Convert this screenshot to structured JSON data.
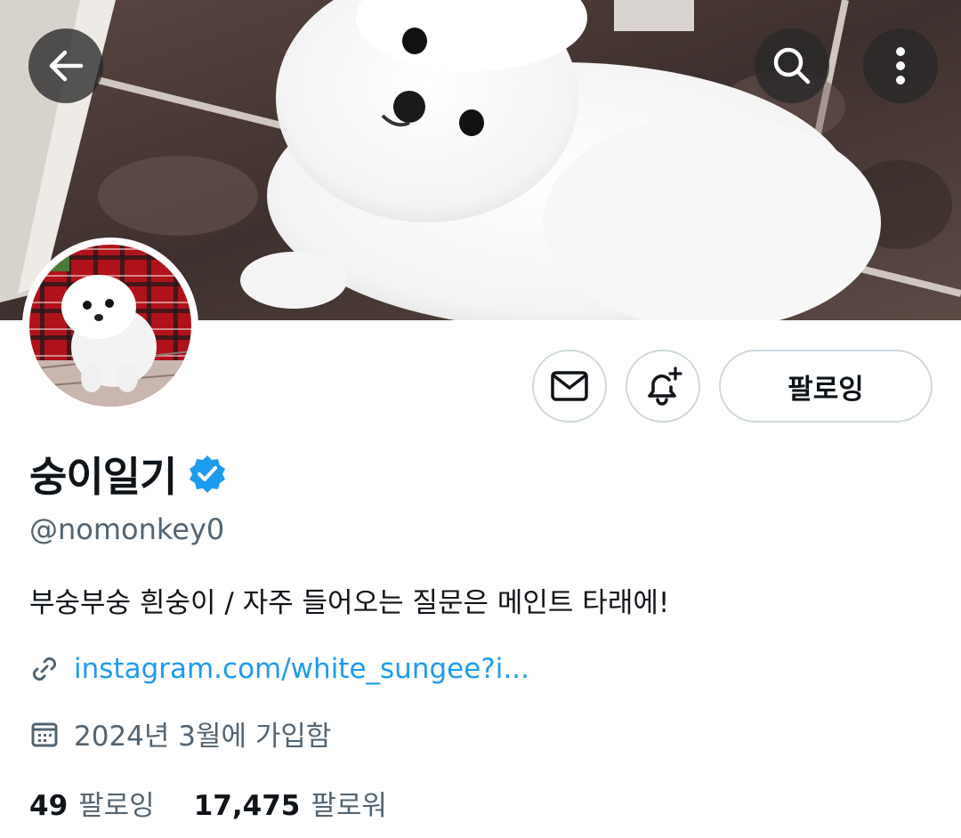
{
  "header": {
    "back_icon": "arrow-left-icon",
    "search_icon": "search-icon",
    "more_icon": "more-vertical-icon"
  },
  "profile": {
    "display_name": "숭이일기",
    "verified": true,
    "handle": "@nomonkey0",
    "bio": "부숭부숭 흰숭이 / 자주 들어오는 질문은 메인트 타래에!",
    "link": "instagram.com/white_sungee?i...",
    "joined": "2024년 3월에 가입함"
  },
  "actions": {
    "message_icon": "mail-icon",
    "notify_icon": "bell-plus-icon",
    "follow_label": "팔로잉"
  },
  "stats": {
    "following_count": "49",
    "following_label": "팔로잉",
    "followers_count": "17,475",
    "followers_label": "팔로워"
  },
  "colors": {
    "accent": "#1d9bf0",
    "text_primary": "#0f1419",
    "text_secondary": "#536471",
    "border": "#cfd9de"
  }
}
